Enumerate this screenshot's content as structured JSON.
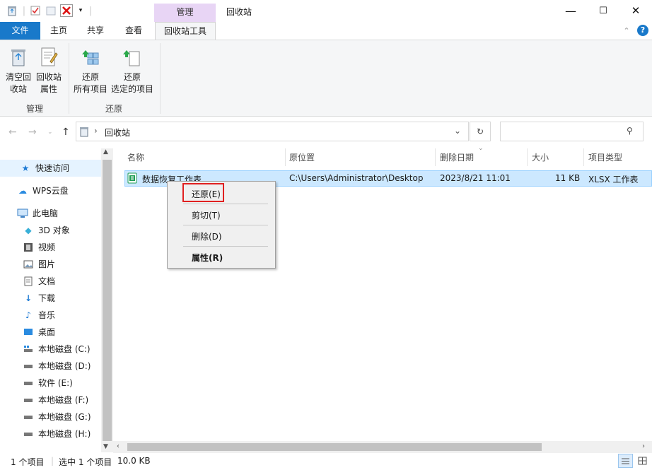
{
  "titlebar": {
    "context_tab": "管理",
    "title": "回收站",
    "minimize": "—",
    "maximize": "☐",
    "close": "✕"
  },
  "tabs": {
    "file": "文件",
    "home": "主页",
    "share": "共享",
    "view": "查看",
    "recycle_tools": "回收站工具"
  },
  "ribbon": {
    "empty_bin": [
      "清空回",
      "收站"
    ],
    "bin_props": [
      "回收站",
      "属性"
    ],
    "restore_all": [
      "还原",
      "所有项目"
    ],
    "restore_selected": [
      "还原",
      "选定的项目"
    ],
    "group_manage": "管理",
    "group_restore": "还原"
  },
  "address": {
    "path": "回收站",
    "search_placeholder": ""
  },
  "nav": {
    "quick_access": "快速访问",
    "wps_cloud": "WPS云盘",
    "this_pc": "此电脑",
    "objects3d": "3D 对象",
    "videos": "视频",
    "pictures": "图片",
    "documents": "文档",
    "downloads": "下载",
    "music": "音乐",
    "desktop": "桌面",
    "drive_c": "本地磁盘 (C:)",
    "drive_d": "本地磁盘 (D:)",
    "drive_e": "软件 (E:)",
    "drive_f": "本地磁盘 (F:)",
    "drive_g": "本地磁盘 (G:)",
    "drive_h": "本地磁盘 (H:)"
  },
  "columns": {
    "name": "名称",
    "location": "原位置",
    "deleted": "删除日期",
    "size": "大小",
    "type": "项目类型"
  },
  "file": {
    "name": "数据恢复工作表",
    "location": "C:\\Users\\Administrator\\Desktop",
    "deleted": "2023/8/21 11:01",
    "size": "11 KB",
    "type": "XLSX 工作表"
  },
  "context_menu": {
    "restore": "还原(E)",
    "cut": "剪切(T)",
    "delete": "删除(D)",
    "properties": "属性(R)"
  },
  "status": {
    "count": "1 个项目",
    "selected": "选中 1 个项目",
    "size": "10.0 KB"
  }
}
